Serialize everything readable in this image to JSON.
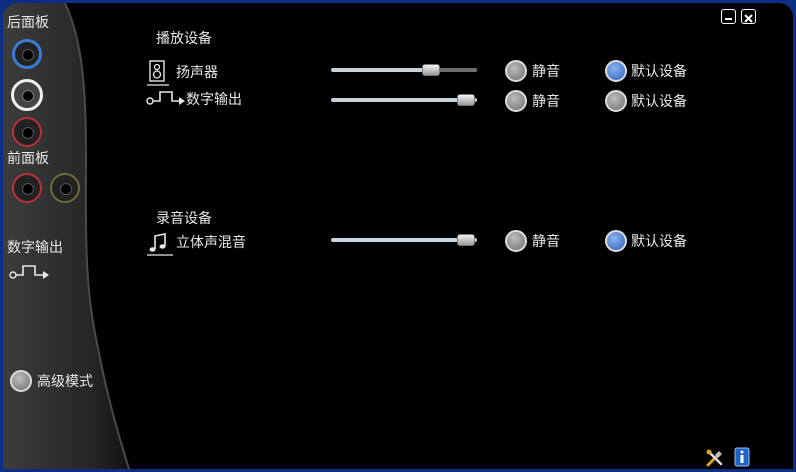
{
  "left_panel": {
    "rear_panel_label": "后面板",
    "front_panel_label": "前面板",
    "digital_out_label": "数字输出",
    "advanced_mode_label": "高级模式"
  },
  "playback": {
    "section_title": "播放设备",
    "devices": [
      {
        "name": "扬声器",
        "mute_label": "静音",
        "default_label": "默认设备",
        "volume": 0.7,
        "default_selected": true
      },
      {
        "name": "数字输出",
        "mute_label": "静音",
        "default_label": "默认设备",
        "volume": 0.93,
        "default_selected": false
      }
    ]
  },
  "recording": {
    "section_title": "录音设备",
    "devices": [
      {
        "name": "立体声混音",
        "mute_label": "静音",
        "default_label": "默认设备",
        "volume": 0.93,
        "default_selected": true
      }
    ]
  },
  "colors": {
    "frame": "#0c2e84",
    "radio_selected": "#2d5fbf",
    "jack_blue": "#3a7bd5",
    "jack_white": "#f0f0f0",
    "jack_red": "#b8313a"
  },
  "icons": [
    "minimize-icon",
    "close-icon",
    "tools-icon",
    "info-icon",
    "speaker-icon",
    "digital-output-icon",
    "music-note-icon"
  ]
}
